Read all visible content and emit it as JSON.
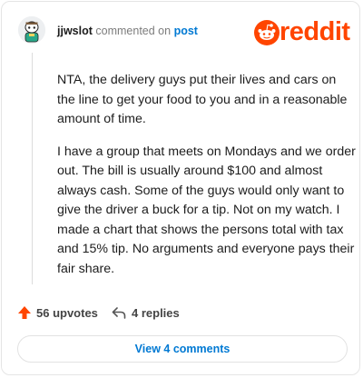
{
  "comment": {
    "username": "jjwslot",
    "action_text": "commented on",
    "target_label": "post",
    "paragraphs": [
      "NTA, the delivery guys put their lives and cars on the line to get your food to you and in a reasonable amount of time.",
      "I have a group that meets on Mondays and we order out. The bill is usually around $100 and almost always cash. Some of the guys would only want to give the driver a buck for a tip. Not on my watch. I made a chart that shows the persons total with tax and 15% tip. No arguments and everyone pays their fair share."
    ]
  },
  "branding": {
    "logo_text": "reddit",
    "brand_color": "#ff4500",
    "link_color": "#0079d3"
  },
  "footer": {
    "upvotes_label": "56 upvotes",
    "replies_label": "4 replies",
    "upvote_icon": "upvote-arrow-icon",
    "reply_icon": "reply-arrow-icon"
  },
  "view_comments_label": "View 4 comments"
}
